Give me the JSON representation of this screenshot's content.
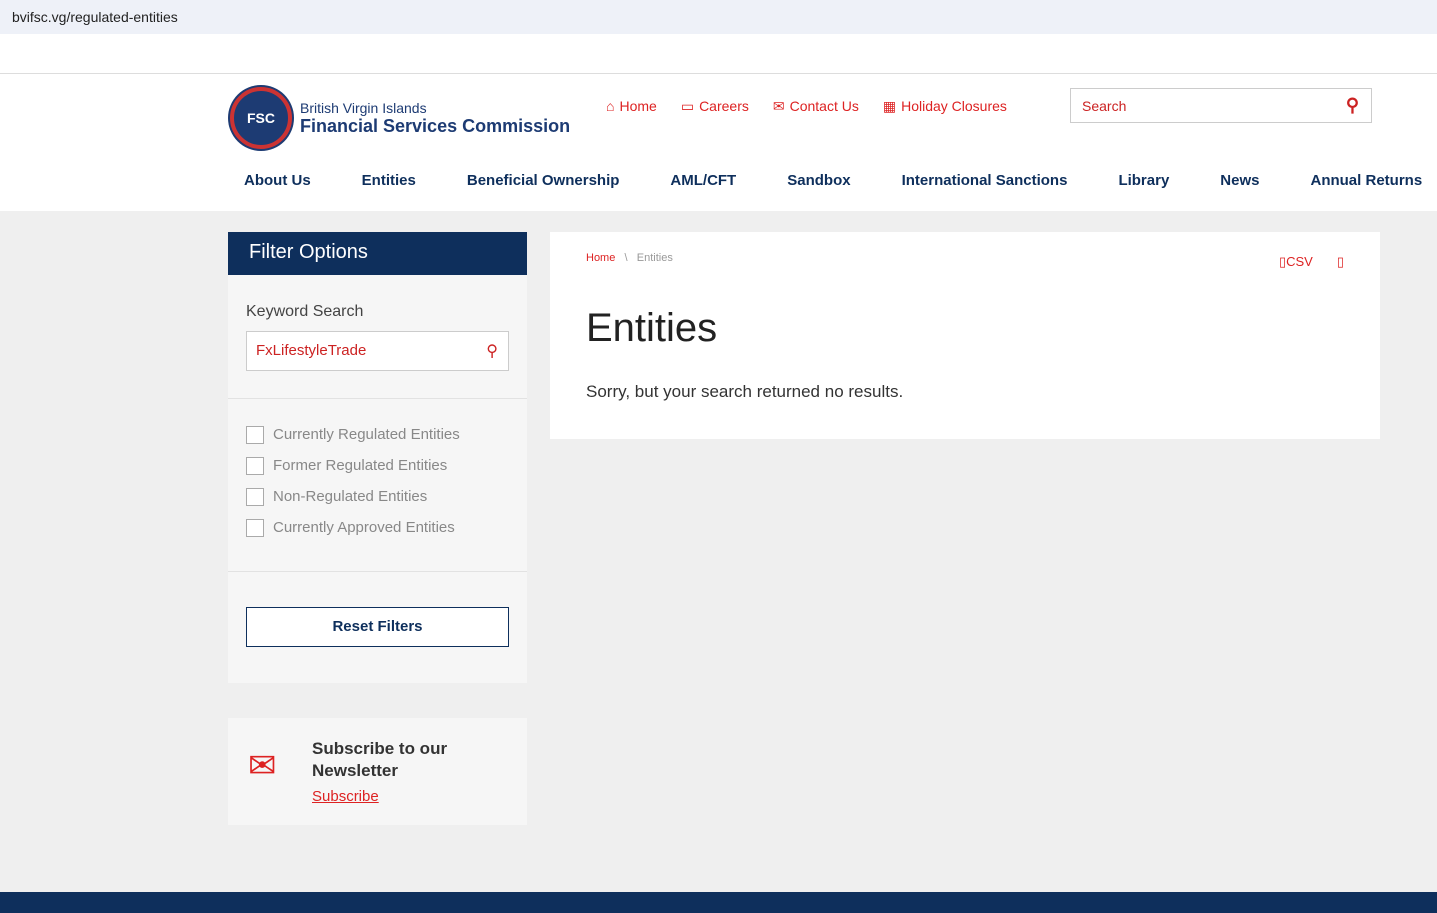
{
  "browser": {
    "url": "bvifsc.vg/regulated-entities"
  },
  "logo": {
    "line1": "British Virgin Islands",
    "line2": "Financial Services Commission",
    "seal": "FSC"
  },
  "toplinks": [
    {
      "icon": "home-icon",
      "label": "Home"
    },
    {
      "icon": "briefcase-icon",
      "label": "Careers"
    },
    {
      "icon": "envelope-icon",
      "label": "Contact Us"
    },
    {
      "icon": "calendar-icon",
      "label": "Holiday Closures"
    }
  ],
  "search": {
    "placeholder": "Search"
  },
  "nav": [
    "About Us",
    "Entities",
    "Beneficial Ownership",
    "AML/CFT",
    "Sandbox",
    "International Sanctions",
    "Library",
    "News",
    "Annual Returns"
  ],
  "filter": {
    "title": "Filter Options",
    "keyword_label": "Keyword Search",
    "keyword_value": "FxLifestyleTrade",
    "checks": [
      "Currently Regulated Entities",
      "Former Regulated Entities",
      "Non-Regulated Entities",
      "Currently Approved Entities"
    ],
    "reset": "Reset Filters"
  },
  "newsletter": {
    "title": "Subscribe to our Newsletter",
    "link": "Subscribe"
  },
  "main": {
    "breadcrumb": [
      "Home",
      "Entities"
    ],
    "sep": "\\",
    "csv": "CSV",
    "title": "Entities",
    "message": "Sorry, but your search returned no results."
  }
}
